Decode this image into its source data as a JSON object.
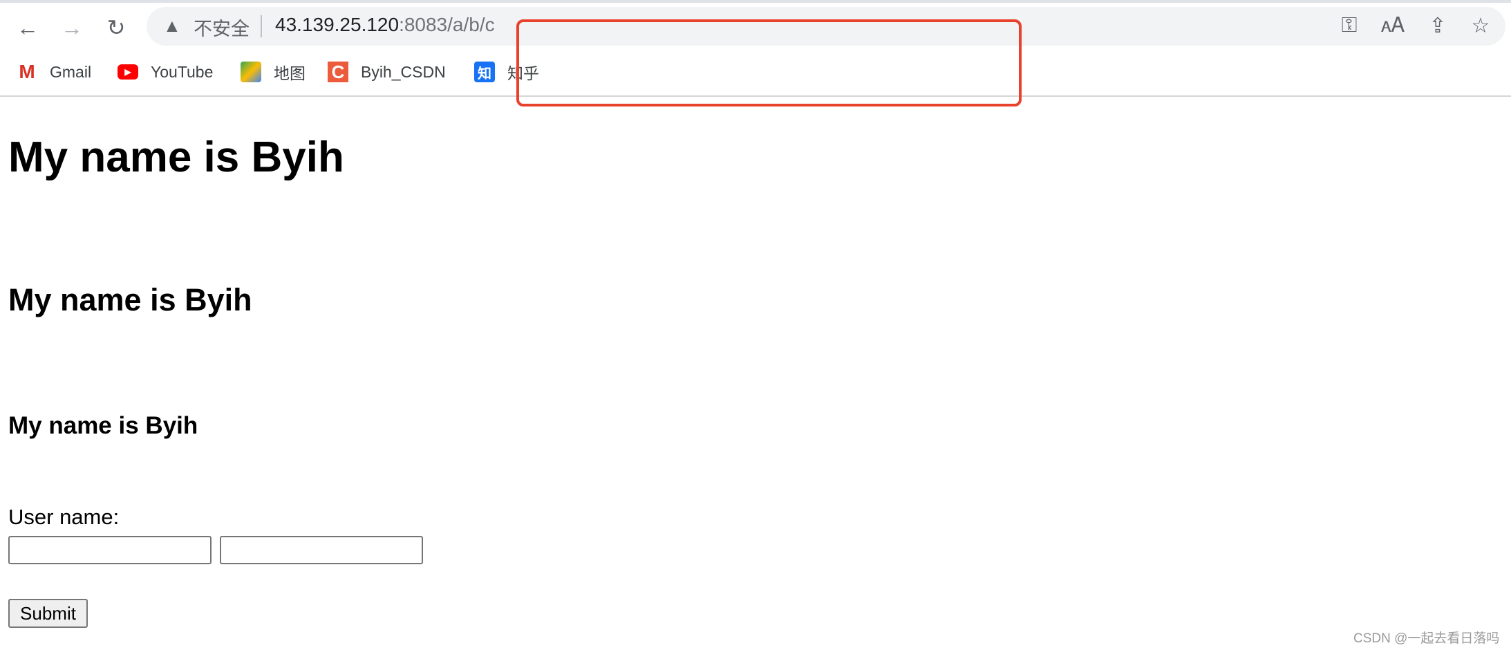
{
  "browser": {
    "address": {
      "security_label": "不安全",
      "host": "43.139.25.120",
      "rest": ":8083/a/b/c"
    },
    "bookmarks": [
      {
        "label": "Gmail",
        "icon": "gmail-icon",
        "color": "#d93025"
      },
      {
        "label": "YouTube",
        "icon": "youtube-icon",
        "color": "#ff0000"
      },
      {
        "label": "地图",
        "icon": "maps-icon",
        "color": "#34a853"
      },
      {
        "label": "Byih_CSDN",
        "icon": "csdn-icon",
        "color": "#ec5c3c"
      },
      {
        "label": "知乎",
        "icon": "zhihu-icon",
        "color": "#1772f6",
        "glyph": "知"
      }
    ]
  },
  "page": {
    "h1": "My name is Byih",
    "h2": "My name is Byih",
    "h3": "My name is Byih",
    "form": {
      "label": "User name:",
      "input1": "",
      "input2": "",
      "submit": "Submit"
    }
  },
  "watermark": "CSDN @一起去看日落吗",
  "annotation_color": "#e8412c"
}
